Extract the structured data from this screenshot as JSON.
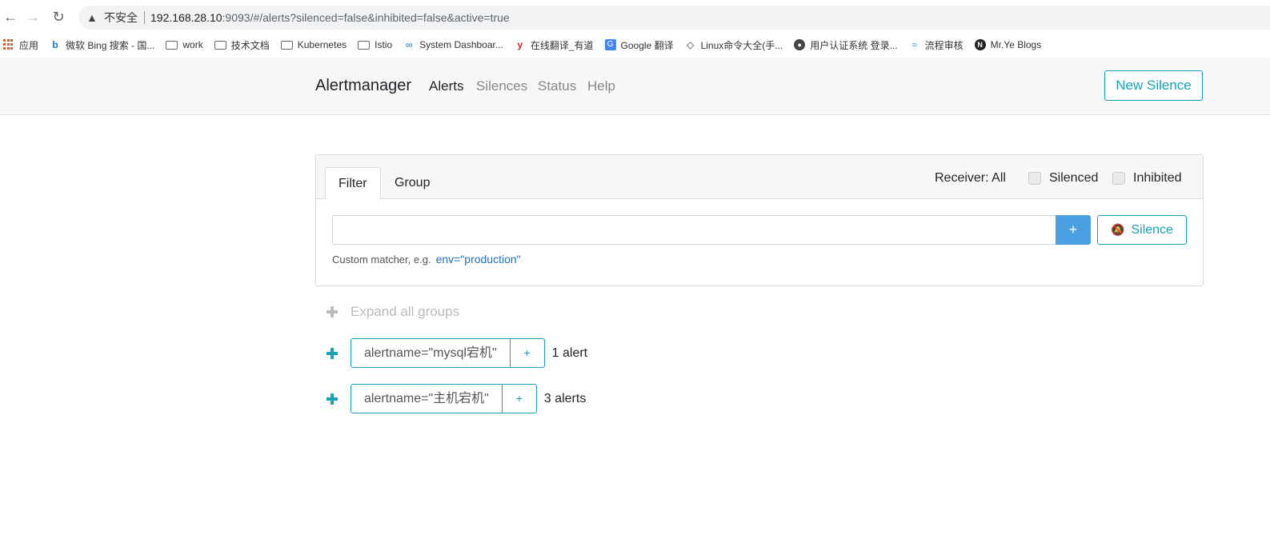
{
  "browser": {
    "url_insecure": "不安全",
    "url_host": "192.168.28.10",
    "url_rest": ":9093/#/alerts?silenced=false&inhibited=false&active=true"
  },
  "bookmarks": [
    {
      "label": "应用",
      "icon": "apps-grid-icon"
    },
    {
      "label": "微软 Bing 搜索 - 国...",
      "icon": "bing-icon"
    },
    {
      "label": "work",
      "icon": "folder-icon"
    },
    {
      "label": "技术文档",
      "icon": "folder-icon"
    },
    {
      "label": "Kubernetes",
      "icon": "folder-icon"
    },
    {
      "label": "Istio",
      "icon": "folder-icon"
    },
    {
      "label": "System Dashboar...",
      "icon": "infinity-icon"
    },
    {
      "label": "在线翻译_有道",
      "icon": "youdao-icon"
    },
    {
      "label": "Google 翻译",
      "icon": "google-translate-icon"
    },
    {
      "label": "Linux命令大全(手...",
      "icon": "linux-icon"
    },
    {
      "label": "用户认证系统 登录...",
      "icon": "globe-icon"
    },
    {
      "label": "流程审核",
      "icon": "flow-icon"
    },
    {
      "label": "Mr.Ye Blogs",
      "icon": "blog-icon"
    }
  ],
  "navbar": {
    "brand": "Alertmanager",
    "links": [
      "Alerts",
      "Silences",
      "Status",
      "Help"
    ],
    "new_silence": "New Silence"
  },
  "filter": {
    "tabs": [
      "Filter",
      "Group"
    ],
    "receiver": "Receiver: All",
    "silenced": "Silenced",
    "inhibited": "Inhibited",
    "input_value": "",
    "add": "+",
    "silence": "Silence",
    "hint": "Custom matcher, e.g.",
    "hint_example": "env=\"production\""
  },
  "groups": {
    "expand_all": "Expand all groups",
    "items": [
      {
        "matcher": "alertname=\"mysql宕机\"",
        "add": "+",
        "count": "1 alert"
      },
      {
        "matcher": "alertname=\"主机宕机\"",
        "add": "+",
        "count": "3 alerts"
      }
    ]
  },
  "colors": {
    "accent": "#17a2b8",
    "primary": "#4a9fe0"
  }
}
